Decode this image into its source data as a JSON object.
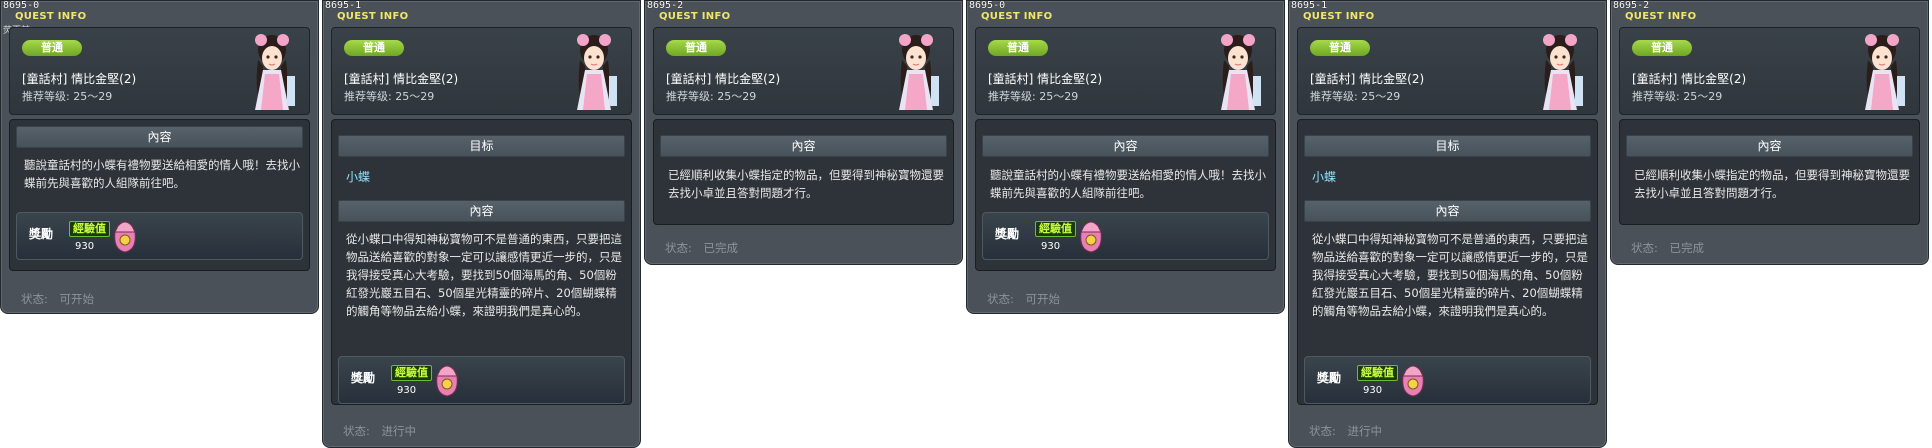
{
  "windows": [
    {
      "tag": "8695-0",
      "title": "QUEST INFO",
      "subtitle": "荧戛前",
      "badge": "普通",
      "quest_name": "[童話村] 情比金堅(2)",
      "level": "推荐等级:  25～29",
      "sections": [
        {
          "type": "header",
          "label": "內容"
        },
        {
          "type": "text",
          "value": "聽說童話村的小蝶有禮物要送給相愛的情人哦！去找小蝶前先與喜歡的人組隊前往吧。"
        }
      ],
      "reward": {
        "label": "獎勵",
        "exp_label": "經驗值",
        "exp_value": "930"
      },
      "status_label": "状态:",
      "status_value": "可开始"
    },
    {
      "tag": "8695-1",
      "title": "QUEST INFO",
      "badge": "普通",
      "quest_name": "[童話村] 情比金堅(2)",
      "level": "推荐等级:  25～29",
      "sections": [
        {
          "type": "header",
          "label": "目标"
        },
        {
          "type": "link",
          "value": "小蝶"
        },
        {
          "type": "header",
          "label": "內容"
        },
        {
          "type": "text",
          "value": "從小蝶口中得知神秘寶物可不是普通的東西，只要把這物品送給喜歡的對象一定可以讓感情更近一步的，只是我得接受真心大考驗，要找到50個海馬的角、50個粉紅發光巖五目石、50個星光精靈的碎片、20個蝴蝶精的觸角等物品去給小蝶，來證明我們是真心的。"
        }
      ],
      "reward": {
        "label": "獎勵",
        "exp_label": "經驗值",
        "exp_value": "930"
      },
      "status_label": "状态:",
      "status_value": "进行中"
    },
    {
      "tag": "8695-2",
      "title": "QUEST INFO",
      "badge": "普通",
      "quest_name": "[童話村] 情比金堅(2)",
      "level": "推荐等级:  25～29",
      "sections": [
        {
          "type": "header",
          "label": "內容"
        },
        {
          "type": "text",
          "value": "已經順利收集小蝶指定的物品，但要得到神秘寶物還要去找小卓並且答對問題才行。"
        }
      ],
      "status_label": "状态:",
      "status_value": "已完成"
    },
    {
      "tag": "8695-0",
      "title": "QUEST INFO",
      "badge": "普通",
      "quest_name": "[童話村] 情比金堅(2)",
      "level": "推荐等级:  25～29",
      "sections": [
        {
          "type": "header",
          "label": "內容"
        },
        {
          "type": "text",
          "value": "聽說童話村的小蝶有禮物要送給相愛的情人哦！去找小蝶前先與喜歡的人組隊前往吧。"
        }
      ],
      "reward": {
        "label": "獎勵",
        "exp_label": "經驗值",
        "exp_value": "930"
      },
      "status_label": "状态:",
      "status_value": "可开始"
    },
    {
      "tag": "8695-1",
      "title": "QUEST INFO",
      "badge": "普通",
      "quest_name": "[童話村] 情比金堅(2)",
      "level": "推荐等级:  25～29",
      "sections": [
        {
          "type": "header",
          "label": "目标"
        },
        {
          "type": "link",
          "value": "小蝶"
        },
        {
          "type": "header",
          "label": "內容"
        },
        {
          "type": "text",
          "value": "從小蝶口中得知神秘寶物可不是普通的東西，只要把這物品送給喜歡的對象一定可以讓感情更近一步的，只是我得接受真心大考驗，要找到50個海馬的角、50個粉紅發光巖五目石、50個星光精靈的碎片、20個蝴蝶精的觸角等物品去給小蝶，來證明我們是真心的。"
        }
      ],
      "reward": {
        "label": "獎勵",
        "exp_label": "經驗值",
        "exp_value": "930"
      },
      "status_label": "状态:",
      "status_value": "进行中"
    },
    {
      "tag": "8695-2",
      "title": "QUEST INFO",
      "badge": "普通",
      "quest_name": "[童話村] 情比金堅(2)",
      "level": "推荐等级:  25～29",
      "sections": [
        {
          "type": "header",
          "label": "內容"
        },
        {
          "type": "text",
          "value": "已經順利收集小蝶指定的物品，但要得到神秘寶物還要去找小卓並且答對問題才行。"
        }
      ],
      "status_label": "状态:",
      "status_value": "已完成"
    }
  ]
}
